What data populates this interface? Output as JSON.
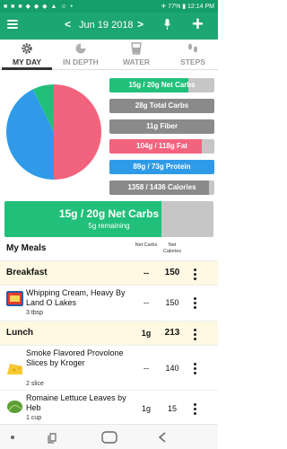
{
  "statusbar": {
    "left_icons": "■ ■ ■ ◆ ◆ ◆ ▲ ☺ •",
    "right": "✈ 77% ▮ 12:14 PM"
  },
  "toolbar": {
    "date": "Jun 19 2018",
    "back": "<",
    "forward": ">"
  },
  "tabs": [
    {
      "label": "MY DAY",
      "icon": "gear-icon",
      "active": true
    },
    {
      "label": "IN DEPTH",
      "icon": "pie-chart-icon",
      "active": false
    },
    {
      "label": "WATER",
      "icon": "water-glass-icon",
      "active": false
    },
    {
      "label": "STEPS",
      "icon": "footsteps-icon",
      "active": false
    }
  ],
  "pie_chart": {
    "slices": [
      {
        "name": "Fat",
        "value": 104,
        "color": "#f2637e"
      },
      {
        "name": "Protein",
        "value": 89,
        "color": "#2f9be8"
      },
      {
        "name": "Net Carbs",
        "value": 15,
        "color": "#21c07a"
      }
    ]
  },
  "summary": {
    "net_carbs": "15g / 20g Net Carbs",
    "total_carbs": "28g Total Carbs",
    "fiber": "11g Fiber",
    "fat": "104g / 118g Fat",
    "protein": "89g / 73g Protein",
    "calories": "1358 / 1436 Calories",
    "net_carbs_fill": 0.75,
    "fat_fill": 0.88,
    "protein_fill": 1.0,
    "calories_fill": 0.95
  },
  "banner": {
    "title": "15g / 20g Net Carbs",
    "subtitle": "5g remaining",
    "fill": 0.75
  },
  "meals_header": {
    "title": "My Meals",
    "col1": "Net Carbs",
    "col2": "Net Calories"
  },
  "meals": [
    {
      "name": "Breakfast",
      "carbs": "--",
      "calories": "150"
    },
    {
      "name": "Lunch",
      "carbs": "1g",
      "calories": "213"
    }
  ],
  "foods": [
    {
      "name": "Whipping Cream, Heavy By Land O Lakes",
      "serving": "3 tbsp",
      "carbs": "--",
      "calories": "150",
      "icon": "cream-carton-icon"
    },
    {
      "name": "Smoke Flavored Provolone Slices by Kroger",
      "serving": "2 slice",
      "carbs": "--",
      "calories": "140",
      "icon": "cheese-icon"
    },
    {
      "name": "Romaine Lettuce Leaves by Heb",
      "serving": "1 cup",
      "carbs": "1g",
      "calories": "15",
      "icon": "lettuce-icon"
    }
  ],
  "colors": {
    "brand_green": "#1ca672",
    "fat_pink": "#f2637e",
    "protein_blue": "#2f9be8",
    "carb_green": "#21c07a",
    "gray_pill": "#8a8a8a"
  }
}
